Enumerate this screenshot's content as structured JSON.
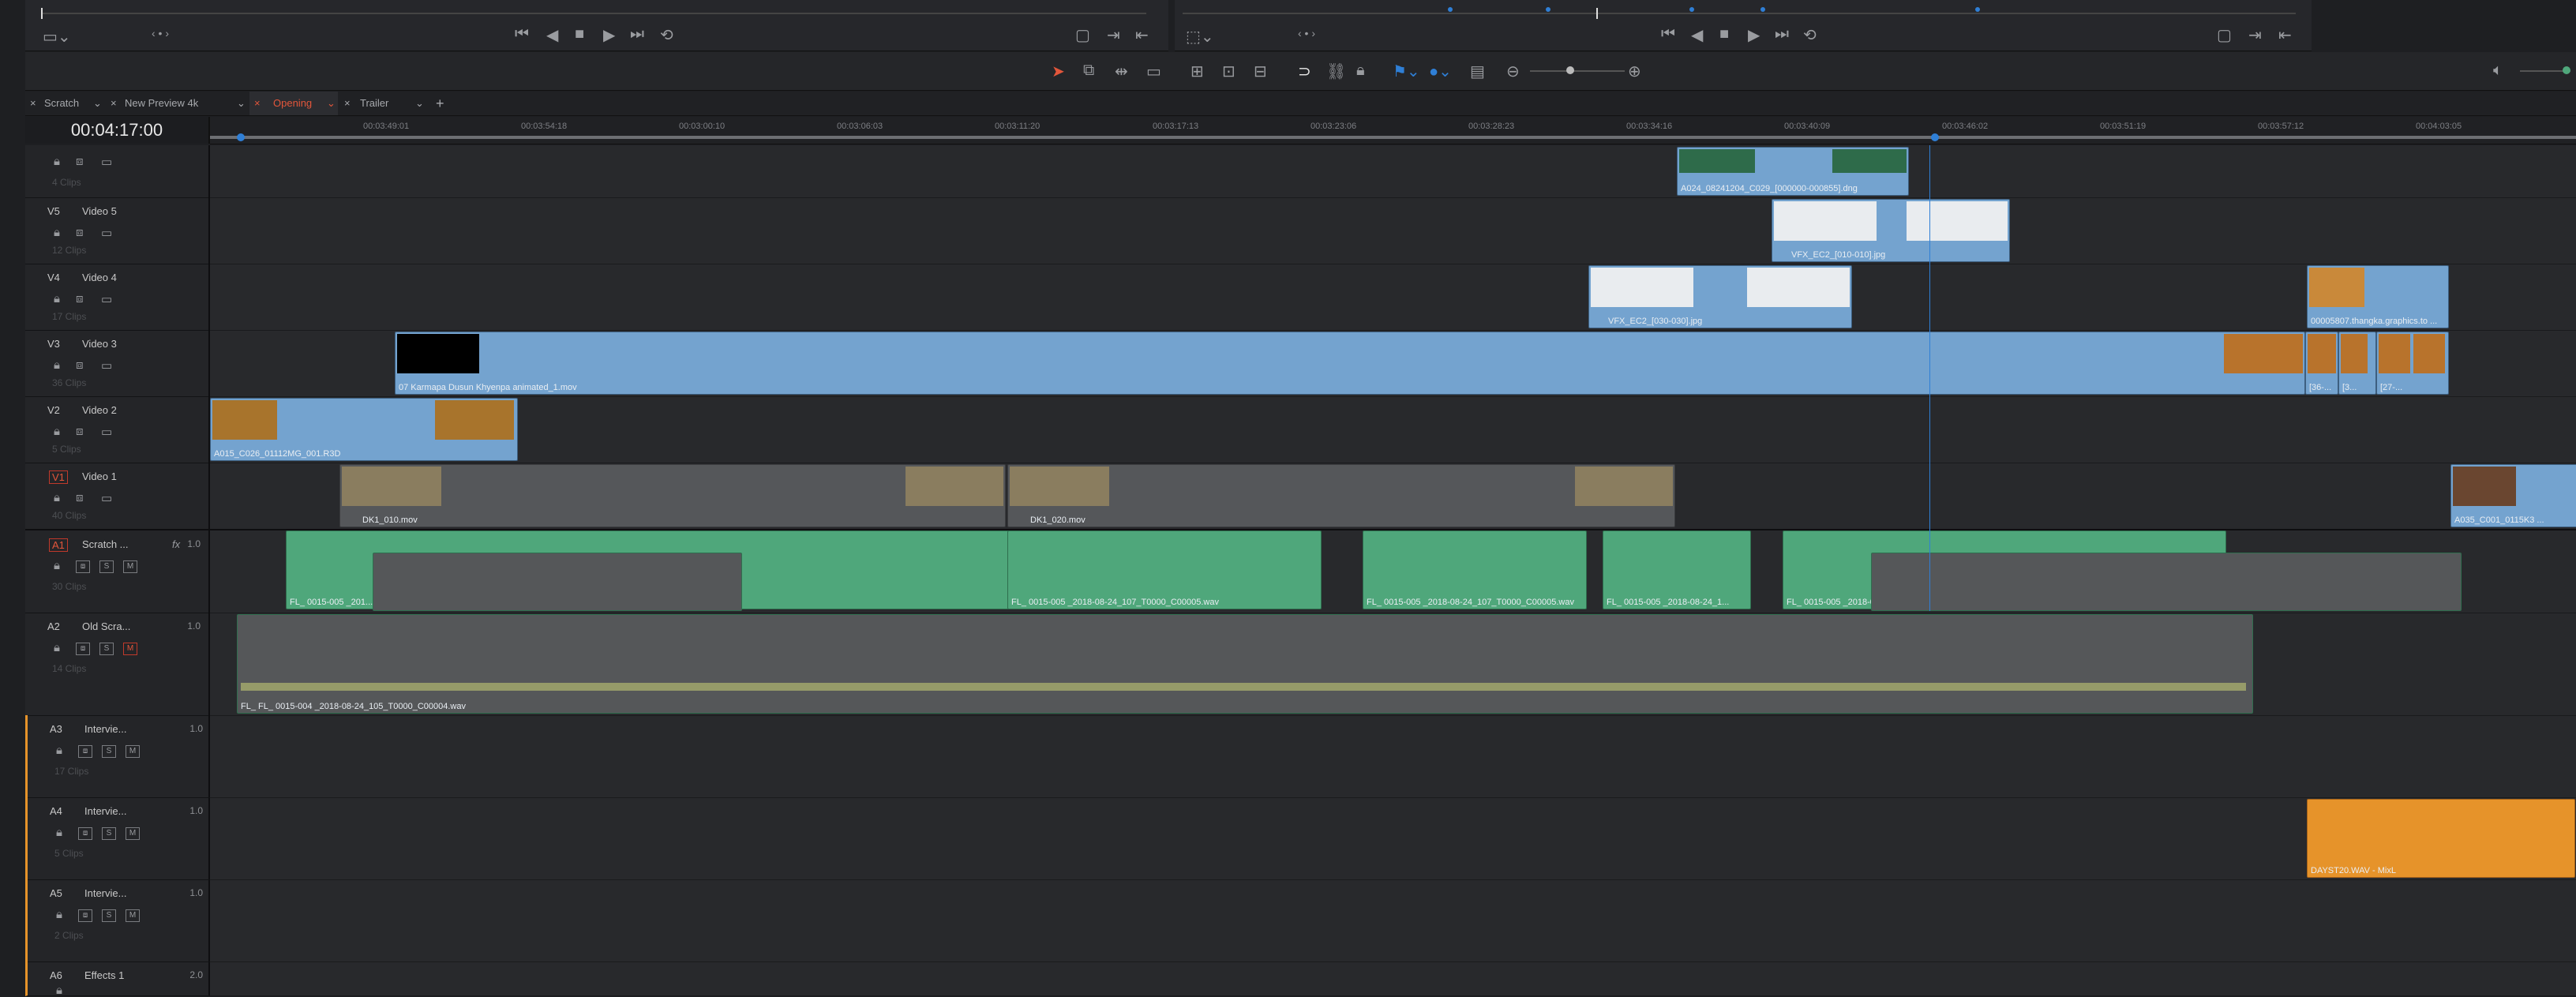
{
  "timecode": "00:04:17:00",
  "tabs": [
    {
      "label": "Scratch",
      "active": false
    },
    {
      "label": "New Preview 4k",
      "active": false
    },
    {
      "label": "Opening",
      "active": true
    },
    {
      "label": "Trailer",
      "active": false
    }
  ],
  "ruler_ticks": [
    "00:03:49:01",
    "00:03:54:18",
    "00:03:00:10",
    "00:03:06:03",
    "00:03:11:20",
    "00:03:17:13",
    "00:03:23:06",
    "00:03:28:23",
    "00:03:34:16",
    "00:03:40:09",
    "00:03:46:02",
    "00:03:51:19",
    "00:03:57:12",
    "00:04:03:05"
  ],
  "tracks": {
    "v6": {
      "code": "",
      "name": "",
      "clips": "4 Clips"
    },
    "v5": {
      "code": "V5",
      "name": "Video 5",
      "clips": "12 Clips"
    },
    "v4": {
      "code": "V4",
      "name": "Video 4",
      "clips": "17 Clips"
    },
    "v3": {
      "code": "V3",
      "name": "Video 3",
      "clips": "36 Clips"
    },
    "v2": {
      "code": "V2",
      "name": "Video 2",
      "clips": "5 Clips"
    },
    "v1": {
      "code": "V1",
      "name": "Video 1",
      "clips": "40 Clips"
    },
    "a1": {
      "code": "A1",
      "name": "Scratch ...",
      "clips": "30 Clips",
      "vol": "1.0",
      "fx": "fx"
    },
    "a2": {
      "code": "A2",
      "name": "Old Scra...",
      "clips": "14 Clips",
      "vol": "1.0"
    },
    "a3": {
      "code": "A3",
      "name": "Intervie...",
      "clips": "17 Clips",
      "vol": "1.0"
    },
    "a4": {
      "code": "A4",
      "name": "Intervie...",
      "clips": "5 Clips",
      "vol": "1.0"
    },
    "a5": {
      "code": "A5",
      "name": "Intervie...",
      "clips": "2 Clips",
      "vol": "1.0"
    },
    "a6": {
      "code": "A6",
      "name": "Effects 1",
      "clips": "",
      "vol": "2.0"
    }
  },
  "clips": {
    "v6_a": "A024_08241204_C029_[000000-000855].dng",
    "v5_a": "VFX_EC2_[010-010].jpg",
    "v4_a": "VFX_EC2_[030-030].jpg",
    "v4_b": "00005807.thangka.graphics.to ...",
    "v3_a": "07 Karmapa Dusun Khyenpa animated_1.mov",
    "v3_b": "[36-...",
    "v3_c": "[3...",
    "v3_d": "[27-...",
    "v2_a": "A015_C026_01112MG_001.R3D",
    "v1_a": "DK1_010.mov",
    "v1_b": "DK1_020.mov",
    "v1_c": "A035_C001_0115K3 ...",
    "a1_a": "FL_ 0015-005 _201...",
    "a1_b": "FL_ 0015-005 _2018-08-24_107_T0000_C00005.wav",
    "a1_c": "FL_ 0015-005 _2018-08-24_107_T0000_C00005.wav",
    "a1_d": "FL_ 0015-005 _2018-08-24_1...",
    "a1_e": "FL_ 0015-005 _2018-0...",
    "a2_a": "FL_ FL_ 0015-004 _2018-08-24_105_T0000_C00004.wav",
    "a4_a": "DAYST20.WAV - MixL"
  },
  "colors": {
    "video_clip": "#74a3cf",
    "audio_clip": "#4fa77b",
    "orange_clip": "#e6932a",
    "active_tab": "#e2563b",
    "playhead": "#2f7fd6"
  }
}
